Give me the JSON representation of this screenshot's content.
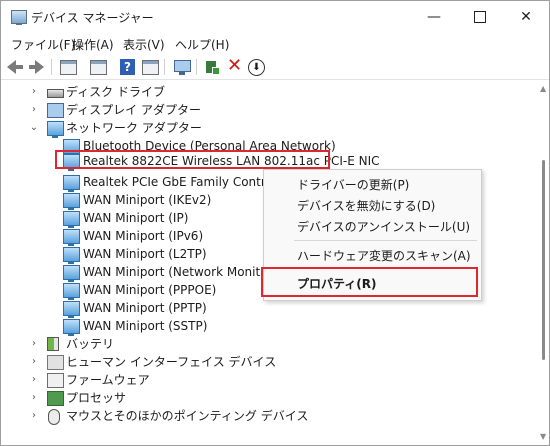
{
  "window": {
    "title": "デバイス マネージャー"
  },
  "menu": [
    "ファイル(F)",
    "操作(A)",
    "表示(V)",
    "ヘルプ(H)"
  ],
  "tree": {
    "categories_top": [
      {
        "label": "ディスク ドライブ",
        "icon": "disk-drive-icon",
        "expanded": false
      },
      {
        "label": "ディスプレイ アダプター",
        "icon": "display-adapter-icon",
        "expanded": false
      },
      {
        "label": "ネットワーク アダプター",
        "icon": "network-adapter-icon",
        "expanded": true
      }
    ],
    "network_devices": [
      "Bluetooth Device (Personal Area Network)",
      "Realtek 8822CE Wireless LAN 802.11ac PCI-E NIC",
      "Realtek PCIe GbE Family Controller",
      "WAN Miniport (IKEv2)",
      "WAN Miniport (IP)",
      "WAN Miniport (IPv6)",
      "WAN Miniport (L2TP)",
      "WAN Miniport (Network Monitor)",
      "WAN Miniport (PPPOE)",
      "WAN Miniport (PPTP)",
      "WAN Miniport (SSTP)"
    ],
    "selected_device": "Realtek 8822CE Wireless LAN 802.11ac PCI-E NIC",
    "categories_bottom": [
      {
        "label": "バッテリ",
        "icon": "battery-icon"
      },
      {
        "label": "ヒューマン インターフェイス デバイス",
        "icon": "hid-icon"
      },
      {
        "label": "ファームウェア",
        "icon": "firmware-icon"
      },
      {
        "label": "プロセッサ",
        "icon": "processor-icon"
      },
      {
        "label": "マウスとそのほかのポインティング デバイス",
        "icon": "mouse-icon"
      }
    ]
  },
  "context_menu": {
    "items": [
      "ドライバーの更新(P)",
      "デバイスを無効にする(D)",
      "デバイスのアンインストール(U)",
      "ハードウェア変更のスキャン(A)",
      "プロパティ(R)"
    ],
    "highlighted": "プロパティ(R)"
  },
  "colors": {
    "highlight_border": "#e0262f",
    "network_icon": "#5aa2dd"
  }
}
